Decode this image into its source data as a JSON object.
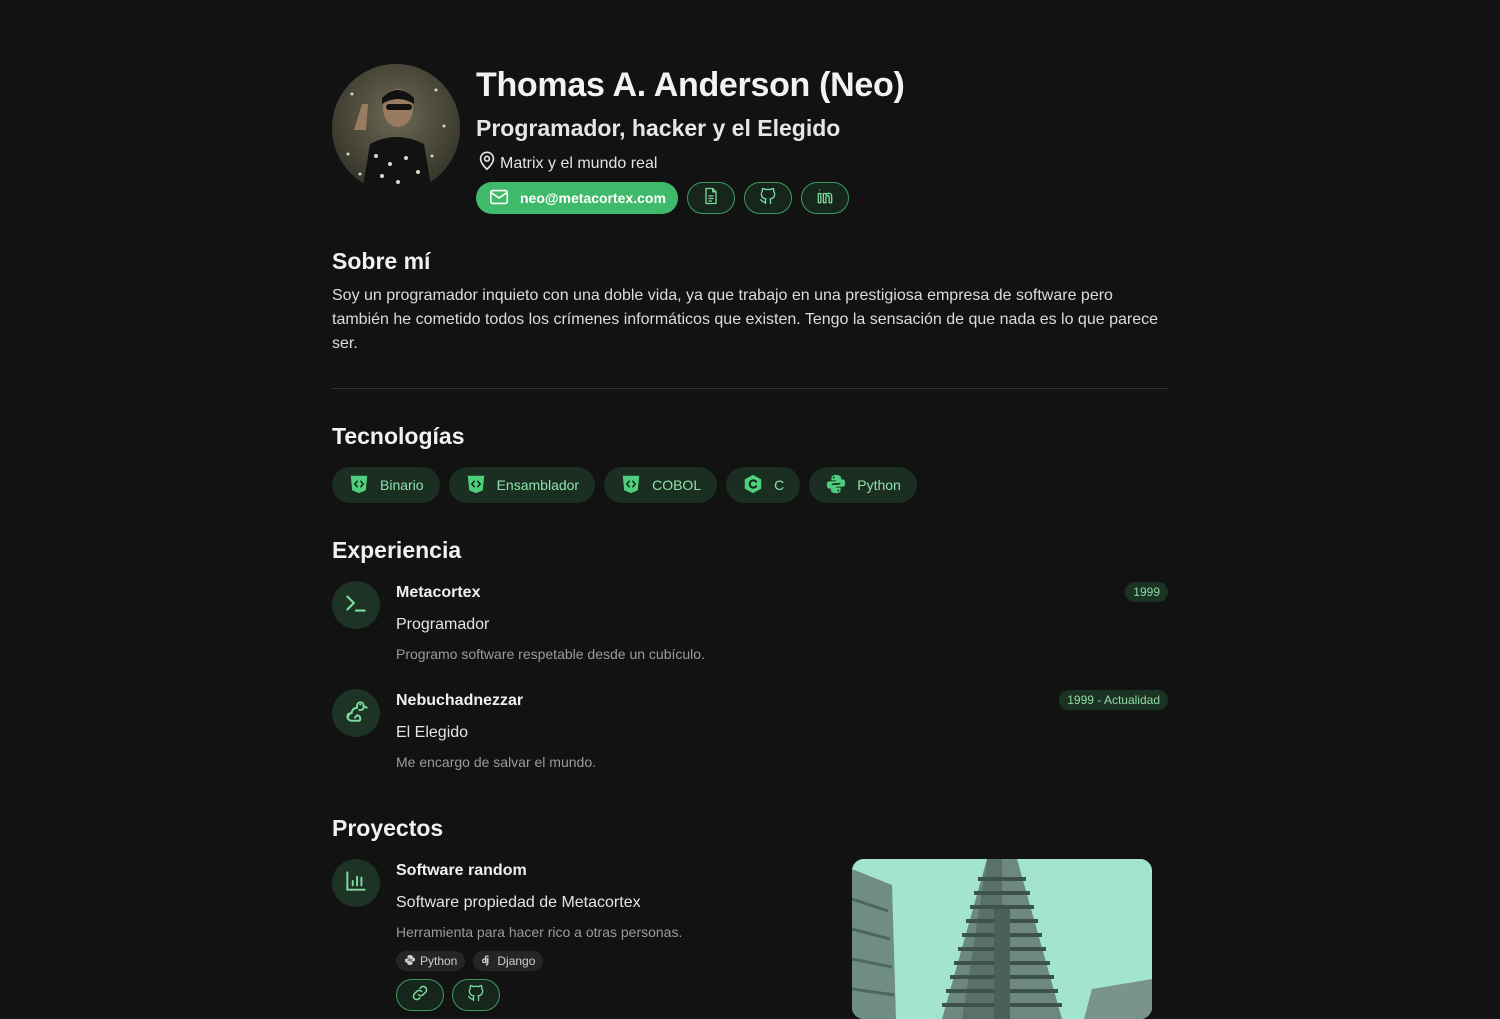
{
  "header": {
    "name": "Thomas A. Anderson (Neo)",
    "subtitle": "Programador, hacker y el Elegido",
    "location": "Matrix y el mundo real",
    "email": "neo@metacortex.com",
    "links": [
      {
        "icon": "document-icon"
      },
      {
        "icon": "github-icon"
      },
      {
        "icon": "linkedin-icon"
      }
    ]
  },
  "about": {
    "title": "Sobre mí",
    "text": "Soy un programador inquieto con una doble vida, ya que trabajo en una prestigiosa empresa de software pero también he cometido todos los crímenes informáticos que existen. Tengo la sensación de que nada es lo que parece ser."
  },
  "tech": {
    "title": "Tecnologías",
    "items": [
      {
        "label": "Binario",
        "icon": "html-shield-icon"
      },
      {
        "label": "Ensamblador",
        "icon": "html-shield-icon"
      },
      {
        "label": "COBOL",
        "icon": "html-shield-icon"
      },
      {
        "label": "C",
        "icon": "c-language-icon"
      },
      {
        "label": "Python",
        "icon": "python-icon"
      }
    ]
  },
  "experience": {
    "title": "Experiencia",
    "items": [
      {
        "company": "Metacortex",
        "role": "Programador",
        "desc": "Programo software respetable desde un cubículo.",
        "date": "1999",
        "icon": "terminal-icon"
      },
      {
        "company": "Nebuchadnezzar",
        "role": "El Elegido",
        "desc": "Me encargo de salvar el mundo.",
        "date": "1999 - Actualidad",
        "icon": "rabbit-icon"
      }
    ]
  },
  "projects": {
    "title": "Proyectos",
    "items": [
      {
        "name": "Software random",
        "subtitle": "Software propiedad de Metacortex",
        "desc": "Herramienta para hacer rico a otras personas.",
        "tags": [
          "Python",
          "Django"
        ],
        "icon": "chart-icon"
      }
    ]
  },
  "colors": {
    "accent": "#3fb96a",
    "background": "#121212",
    "chip_bg": "#1b2e22",
    "chip_text": "#8fe2ab"
  }
}
